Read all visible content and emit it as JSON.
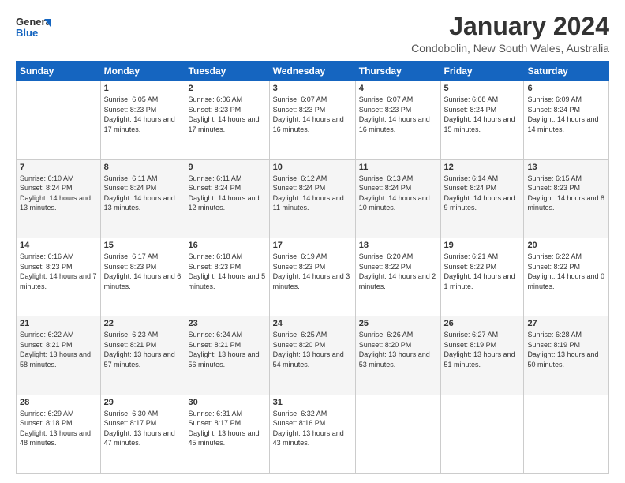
{
  "logo": {
    "text_general": "General",
    "text_blue": "Blue"
  },
  "title": "January 2024",
  "subtitle": "Condobolin, New South Wales, Australia",
  "days_of_week": [
    "Sunday",
    "Monday",
    "Tuesday",
    "Wednesday",
    "Thursday",
    "Friday",
    "Saturday"
  ],
  "weeks": [
    [
      {
        "day": "",
        "sunrise": "",
        "sunset": "",
        "daylight": ""
      },
      {
        "day": "1",
        "sunrise": "Sunrise: 6:05 AM",
        "sunset": "Sunset: 8:23 PM",
        "daylight": "Daylight: 14 hours and 17 minutes."
      },
      {
        "day": "2",
        "sunrise": "Sunrise: 6:06 AM",
        "sunset": "Sunset: 8:23 PM",
        "daylight": "Daylight: 14 hours and 17 minutes."
      },
      {
        "day": "3",
        "sunrise": "Sunrise: 6:07 AM",
        "sunset": "Sunset: 8:23 PM",
        "daylight": "Daylight: 14 hours and 16 minutes."
      },
      {
        "day": "4",
        "sunrise": "Sunrise: 6:07 AM",
        "sunset": "Sunset: 8:23 PM",
        "daylight": "Daylight: 14 hours and 16 minutes."
      },
      {
        "day": "5",
        "sunrise": "Sunrise: 6:08 AM",
        "sunset": "Sunset: 8:24 PM",
        "daylight": "Daylight: 14 hours and 15 minutes."
      },
      {
        "day": "6",
        "sunrise": "Sunrise: 6:09 AM",
        "sunset": "Sunset: 8:24 PM",
        "daylight": "Daylight: 14 hours and 14 minutes."
      }
    ],
    [
      {
        "day": "7",
        "sunrise": "Sunrise: 6:10 AM",
        "sunset": "Sunset: 8:24 PM",
        "daylight": "Daylight: 14 hours and 13 minutes."
      },
      {
        "day": "8",
        "sunrise": "Sunrise: 6:11 AM",
        "sunset": "Sunset: 8:24 PM",
        "daylight": "Daylight: 14 hours and 13 minutes."
      },
      {
        "day": "9",
        "sunrise": "Sunrise: 6:11 AM",
        "sunset": "Sunset: 8:24 PM",
        "daylight": "Daylight: 14 hours and 12 minutes."
      },
      {
        "day": "10",
        "sunrise": "Sunrise: 6:12 AM",
        "sunset": "Sunset: 8:24 PM",
        "daylight": "Daylight: 14 hours and 11 minutes."
      },
      {
        "day": "11",
        "sunrise": "Sunrise: 6:13 AM",
        "sunset": "Sunset: 8:24 PM",
        "daylight": "Daylight: 14 hours and 10 minutes."
      },
      {
        "day": "12",
        "sunrise": "Sunrise: 6:14 AM",
        "sunset": "Sunset: 8:24 PM",
        "daylight": "Daylight: 14 hours and 9 minutes."
      },
      {
        "day": "13",
        "sunrise": "Sunrise: 6:15 AM",
        "sunset": "Sunset: 8:23 PM",
        "daylight": "Daylight: 14 hours and 8 minutes."
      }
    ],
    [
      {
        "day": "14",
        "sunrise": "Sunrise: 6:16 AM",
        "sunset": "Sunset: 8:23 PM",
        "daylight": "Daylight: 14 hours and 7 minutes."
      },
      {
        "day": "15",
        "sunrise": "Sunrise: 6:17 AM",
        "sunset": "Sunset: 8:23 PM",
        "daylight": "Daylight: 14 hours and 6 minutes."
      },
      {
        "day": "16",
        "sunrise": "Sunrise: 6:18 AM",
        "sunset": "Sunset: 8:23 PM",
        "daylight": "Daylight: 14 hours and 5 minutes."
      },
      {
        "day": "17",
        "sunrise": "Sunrise: 6:19 AM",
        "sunset": "Sunset: 8:23 PM",
        "daylight": "Daylight: 14 hours and 3 minutes."
      },
      {
        "day": "18",
        "sunrise": "Sunrise: 6:20 AM",
        "sunset": "Sunset: 8:22 PM",
        "daylight": "Daylight: 14 hours and 2 minutes."
      },
      {
        "day": "19",
        "sunrise": "Sunrise: 6:21 AM",
        "sunset": "Sunset: 8:22 PM",
        "daylight": "Daylight: 14 hours and 1 minute."
      },
      {
        "day": "20",
        "sunrise": "Sunrise: 6:22 AM",
        "sunset": "Sunset: 8:22 PM",
        "daylight": "Daylight: 14 hours and 0 minutes."
      }
    ],
    [
      {
        "day": "21",
        "sunrise": "Sunrise: 6:22 AM",
        "sunset": "Sunset: 8:21 PM",
        "daylight": "Daylight: 13 hours and 58 minutes."
      },
      {
        "day": "22",
        "sunrise": "Sunrise: 6:23 AM",
        "sunset": "Sunset: 8:21 PM",
        "daylight": "Daylight: 13 hours and 57 minutes."
      },
      {
        "day": "23",
        "sunrise": "Sunrise: 6:24 AM",
        "sunset": "Sunset: 8:21 PM",
        "daylight": "Daylight: 13 hours and 56 minutes."
      },
      {
        "day": "24",
        "sunrise": "Sunrise: 6:25 AM",
        "sunset": "Sunset: 8:20 PM",
        "daylight": "Daylight: 13 hours and 54 minutes."
      },
      {
        "day": "25",
        "sunrise": "Sunrise: 6:26 AM",
        "sunset": "Sunset: 8:20 PM",
        "daylight": "Daylight: 13 hours and 53 minutes."
      },
      {
        "day": "26",
        "sunrise": "Sunrise: 6:27 AM",
        "sunset": "Sunset: 8:19 PM",
        "daylight": "Daylight: 13 hours and 51 minutes."
      },
      {
        "day": "27",
        "sunrise": "Sunrise: 6:28 AM",
        "sunset": "Sunset: 8:19 PM",
        "daylight": "Daylight: 13 hours and 50 minutes."
      }
    ],
    [
      {
        "day": "28",
        "sunrise": "Sunrise: 6:29 AM",
        "sunset": "Sunset: 8:18 PM",
        "daylight": "Daylight: 13 hours and 48 minutes."
      },
      {
        "day": "29",
        "sunrise": "Sunrise: 6:30 AM",
        "sunset": "Sunset: 8:17 PM",
        "daylight": "Daylight: 13 hours and 47 minutes."
      },
      {
        "day": "30",
        "sunrise": "Sunrise: 6:31 AM",
        "sunset": "Sunset: 8:17 PM",
        "daylight": "Daylight: 13 hours and 45 minutes."
      },
      {
        "day": "31",
        "sunrise": "Sunrise: 6:32 AM",
        "sunset": "Sunset: 8:16 PM",
        "daylight": "Daylight: 13 hours and 43 minutes."
      },
      {
        "day": "",
        "sunrise": "",
        "sunset": "",
        "daylight": ""
      },
      {
        "day": "",
        "sunrise": "",
        "sunset": "",
        "daylight": ""
      },
      {
        "day": "",
        "sunrise": "",
        "sunset": "",
        "daylight": ""
      }
    ]
  ]
}
